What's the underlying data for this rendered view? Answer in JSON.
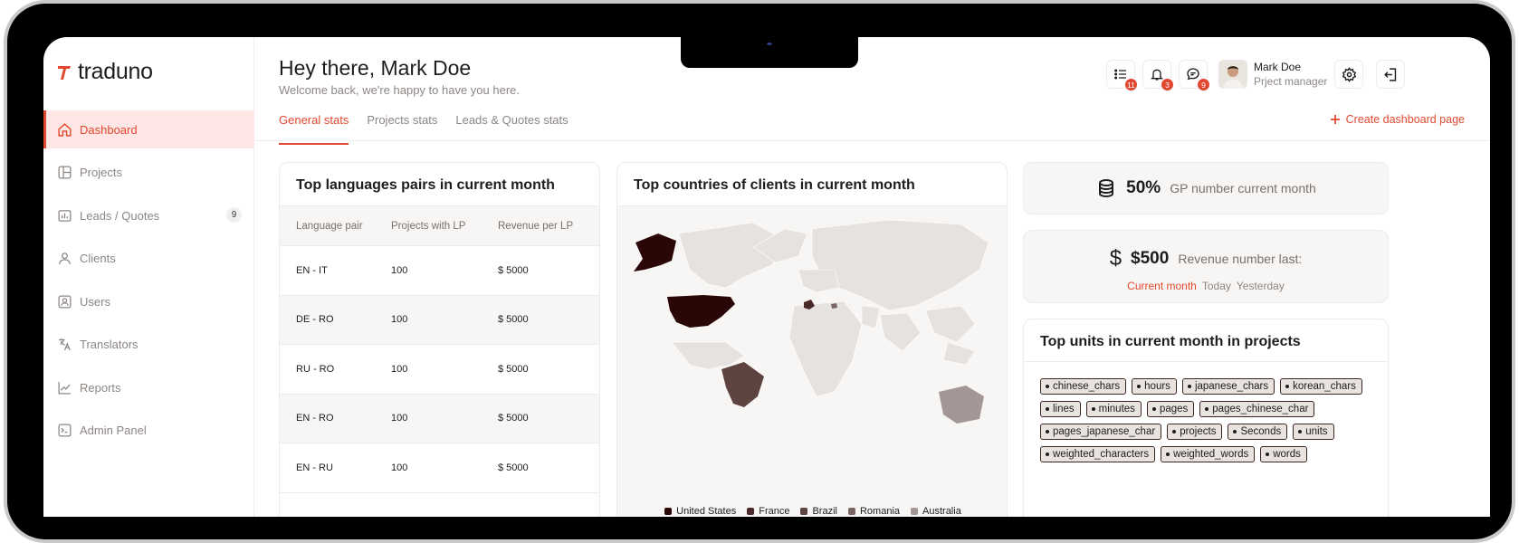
{
  "brand": {
    "name": "traduno",
    "accent": "#e2482f"
  },
  "sidebar": {
    "items": [
      {
        "label": "Dashboard",
        "icon": "home-icon",
        "active": true
      },
      {
        "label": "Projects",
        "icon": "layout-icon"
      },
      {
        "label": "Leads / Quotes",
        "icon": "chart-bars-icon",
        "badge": "9"
      },
      {
        "label": "Clients",
        "icon": "user-icon"
      },
      {
        "label": "Users",
        "icon": "user-card-icon"
      },
      {
        "label": "Translators",
        "icon": "translate-icon"
      },
      {
        "label": "Reports",
        "icon": "trend-icon"
      },
      {
        "label": "Admin Panel",
        "icon": "terminal-icon"
      }
    ]
  },
  "header": {
    "greeting": "Hey there, Mark  Doe",
    "subtitle": "Welcome back, we're happy to have you here.",
    "tabs": [
      "General stats",
      "Projects stats",
      "Leads & Quotes stats"
    ],
    "create_label": "Create dashboard page",
    "counters": {
      "tasks": "11",
      "notifications": "3",
      "messages": "9"
    },
    "user": {
      "name": "Mark  Doe",
      "role": "Prject manager"
    }
  },
  "languages_card": {
    "title": "Top languages pairs in current month",
    "columns": [
      "Language pair",
      "Projects with LP",
      "Revenue per LP"
    ],
    "rows": [
      [
        "EN - IT",
        "100",
        "$ 5000"
      ],
      [
        "DE - RO",
        "100",
        "$ 5000"
      ],
      [
        "RU - RO",
        "100",
        "$ 5000"
      ],
      [
        "EN - RO",
        "100",
        "$ 5000"
      ],
      [
        "EN - RU",
        "100",
        "$ 5000"
      ]
    ]
  },
  "countries_card": {
    "title": "Top countries of clients in current month",
    "legend": [
      {
        "name": "United States",
        "color": "#2b0606"
      },
      {
        "name": "France",
        "color": "#4a2a28"
      },
      {
        "name": "Brazil",
        "color": "#5e4441"
      },
      {
        "name": "Romania",
        "color": "#7a6663"
      },
      {
        "name": "Australia",
        "color": "#a39795"
      }
    ]
  },
  "gp_card": {
    "value": "50%",
    "label": "GP number current month"
  },
  "revenue_card": {
    "value": "$500",
    "label": "Revenue number last:",
    "options": [
      "Current month",
      "Today",
      "Yesterday"
    ]
  },
  "units_card": {
    "title": "Top units in current month in projects",
    "units": [
      "chinese_chars",
      "hours",
      "japanese_chars",
      "korean_chars",
      "lines",
      "minutes",
      "pages",
      "pages_chinese_char",
      "pages_japanese_char",
      "projects",
      "Seconds",
      "units",
      "weighted_characters",
      "weighted_words",
      "words"
    ]
  }
}
